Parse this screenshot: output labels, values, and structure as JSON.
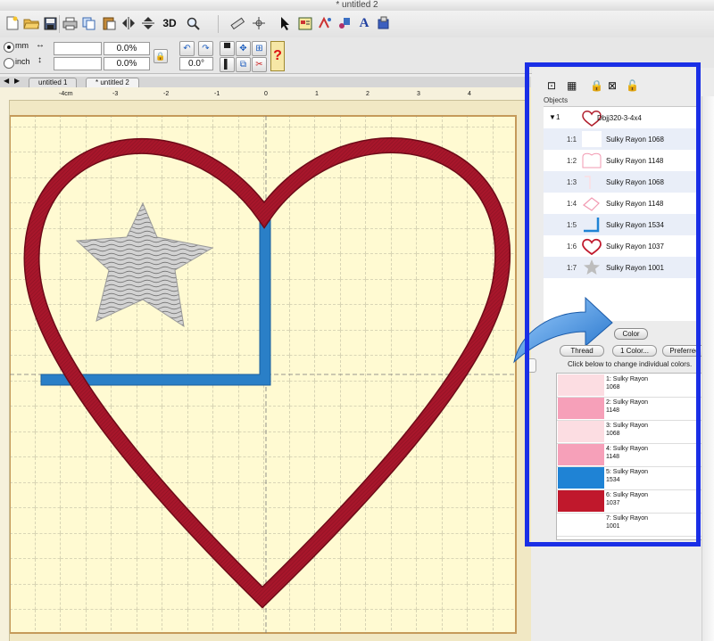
{
  "window": {
    "title": "* untitled 2"
  },
  "toolbar": {
    "icons": [
      "new-icon",
      "open-icon",
      "save-icon",
      "print-icon",
      "copy-icon",
      "paste-icon",
      "flip-horizontal-icon",
      "flip-vertical-icon",
      "3d-icon",
      "zoom-icon",
      "measure-icon",
      "origin-icon",
      "pointer-icon",
      "layout-icon",
      "stitch-icon",
      "text-icon",
      "tools-icon"
    ],
    "three_d_label": "3D"
  },
  "options": {
    "unit_mm": "mm",
    "unit_inch": "inch",
    "width_percent": "0.0%",
    "height_percent": "0.0%",
    "rotation": "0.0°"
  },
  "tabs": [
    "untitled 1",
    "* untitled 2"
  ],
  "ruler": {
    "labels": [
      "-4cm",
      "-3",
      "-2",
      "-1",
      "0",
      "1",
      "2",
      "3",
      "4"
    ]
  },
  "objects": {
    "header": "Objects",
    "group": {
      "index": "1",
      "name": "Dbjj320-3-4x4"
    },
    "items": [
      {
        "index": "1:1",
        "thread": "Sulky Rayon 1068"
      },
      {
        "index": "1:2",
        "thread": "Sulky Rayon 1148"
      },
      {
        "index": "1:3",
        "thread": "Sulky Rayon 1068"
      },
      {
        "index": "1:4",
        "thread": "Sulky Rayon 1148"
      },
      {
        "index": "1:5",
        "thread": "Sulky Rayon 1534"
      },
      {
        "index": "1:6",
        "thread": "Sulky Rayon 1037"
      },
      {
        "index": "1:7",
        "thread": "Sulky Rayon 1001"
      }
    ]
  },
  "color_panel": {
    "button": "Color",
    "thread_button": "Thread",
    "one_color_button": "1 Color...",
    "preferred_button": "Preferred",
    "hint": "Click below to change individual colors.",
    "swatches": [
      {
        "line1": "1: Sulky Rayon",
        "line2": "1068",
        "color": "#fcdde2"
      },
      {
        "line1": "2: Sulky Rayon",
        "line2": "1148",
        "color": "#f6a0b9"
      },
      {
        "line1": "3: Sulky Rayon",
        "line2": "1068",
        "color": "#fcdde2"
      },
      {
        "line1": "4: Sulky Rayon",
        "line2": "1148",
        "color": "#f6a0b9"
      },
      {
        "line1": "5: Sulky Rayon",
        "line2": "1534",
        "color": "#1f83d5"
      },
      {
        "line1": "6: Sulky Rayon",
        "line2": "1037",
        "color": "#c0182c"
      },
      {
        "line1": "7: Sulky Rayon",
        "line2": "1001",
        "color": "#ffffff"
      }
    ]
  },
  "colors": {
    "highlight": "#1a2fe6",
    "heart": "#a8162b",
    "flag_blue": "#2a7fc7",
    "hoop": "#fffad2"
  }
}
